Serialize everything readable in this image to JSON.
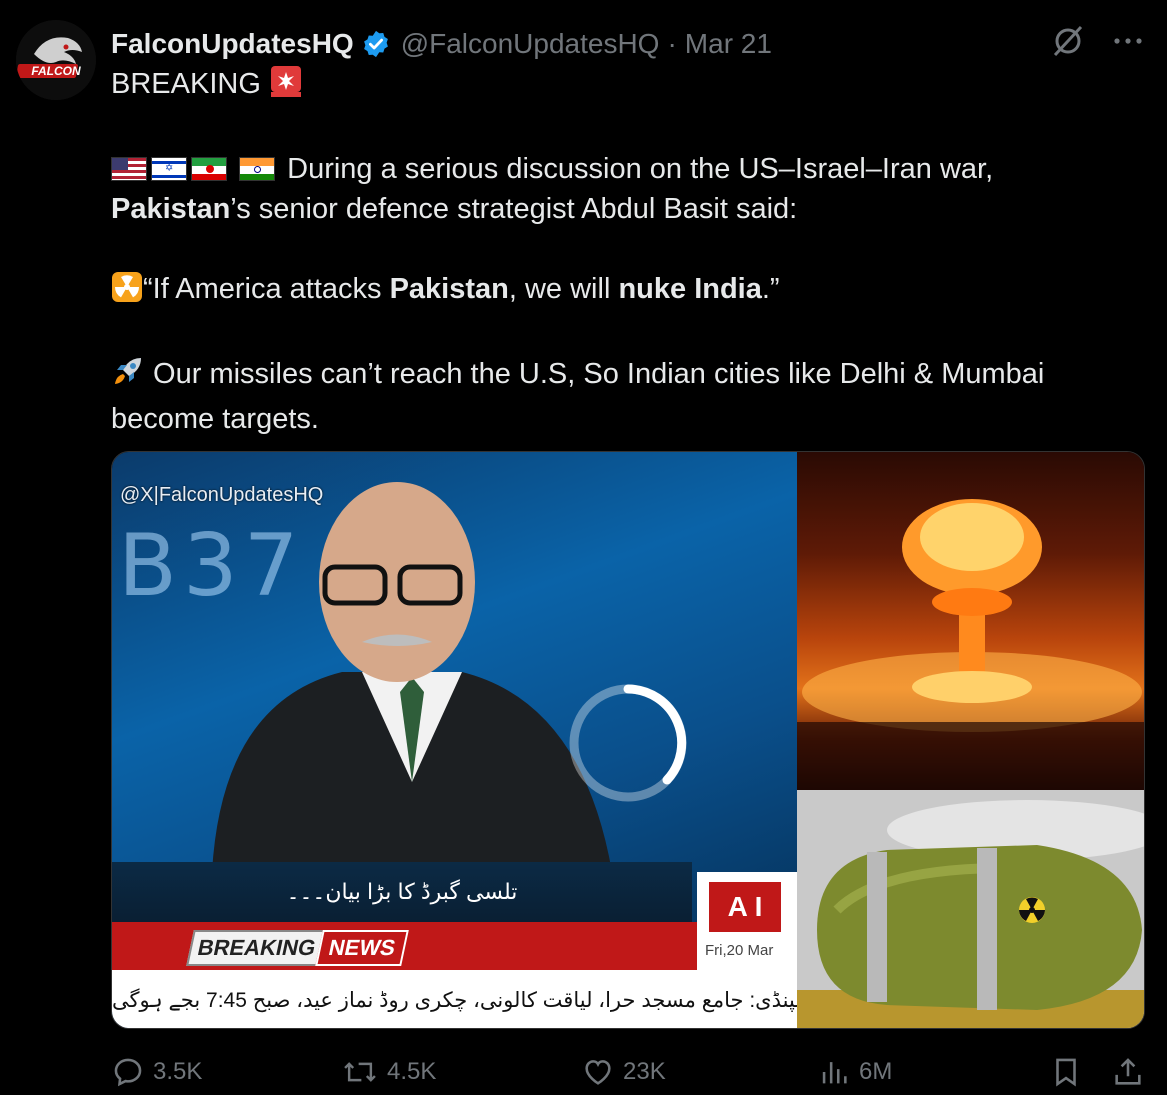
{
  "author": {
    "name": "FalconUpdatesHQ",
    "handle": "@FalconUpdatesHQ",
    "separator": "·",
    "date": "Mar 21",
    "avatar_text": "FALCON"
  },
  "tweet": {
    "line1": "BREAKING",
    "p2_rest": " During a serious discussion on the US–Israel–Iran war,",
    "p2_bold": "Pakistan",
    "p2_tail": "’s senior defence strategist Abdul Basit said:",
    "q_open": "“If America attacks ",
    "q_b1": "Pakistan",
    "q_mid": ", we will ",
    "q_b2": "nuke India",
    "q_close": ".”",
    "p4_l1": " Our missiles can’t reach the U.S, So Indian cities like Delhi & Mumbai",
    "p4_l2": "become targets."
  },
  "media": {
    "watermark": "@X|FalconUpdatesHQ",
    "bg_text": "B37  E2",
    "urdu_caption": "تلسی گبرڈ کا بڑا بیان۔۔۔",
    "breaking": "BREAKING",
    "news": "NEWS",
    "channel": "A I",
    "date": "Fri,20 Mar",
    "ticker": "راولپنڈی: جامع مسجد حرا، لیاقت کالونی، چکری روڈ نماز عید، صبح 7:45 بجے ہوگی"
  },
  "actions": {
    "replies": "3.5K",
    "reposts": "4.5K",
    "likes": "23K",
    "views": "6M"
  },
  "colors": {
    "background": "#000000",
    "text": "#e7e9ea",
    "muted": "#71767b",
    "verified": "#1d9bf0"
  }
}
